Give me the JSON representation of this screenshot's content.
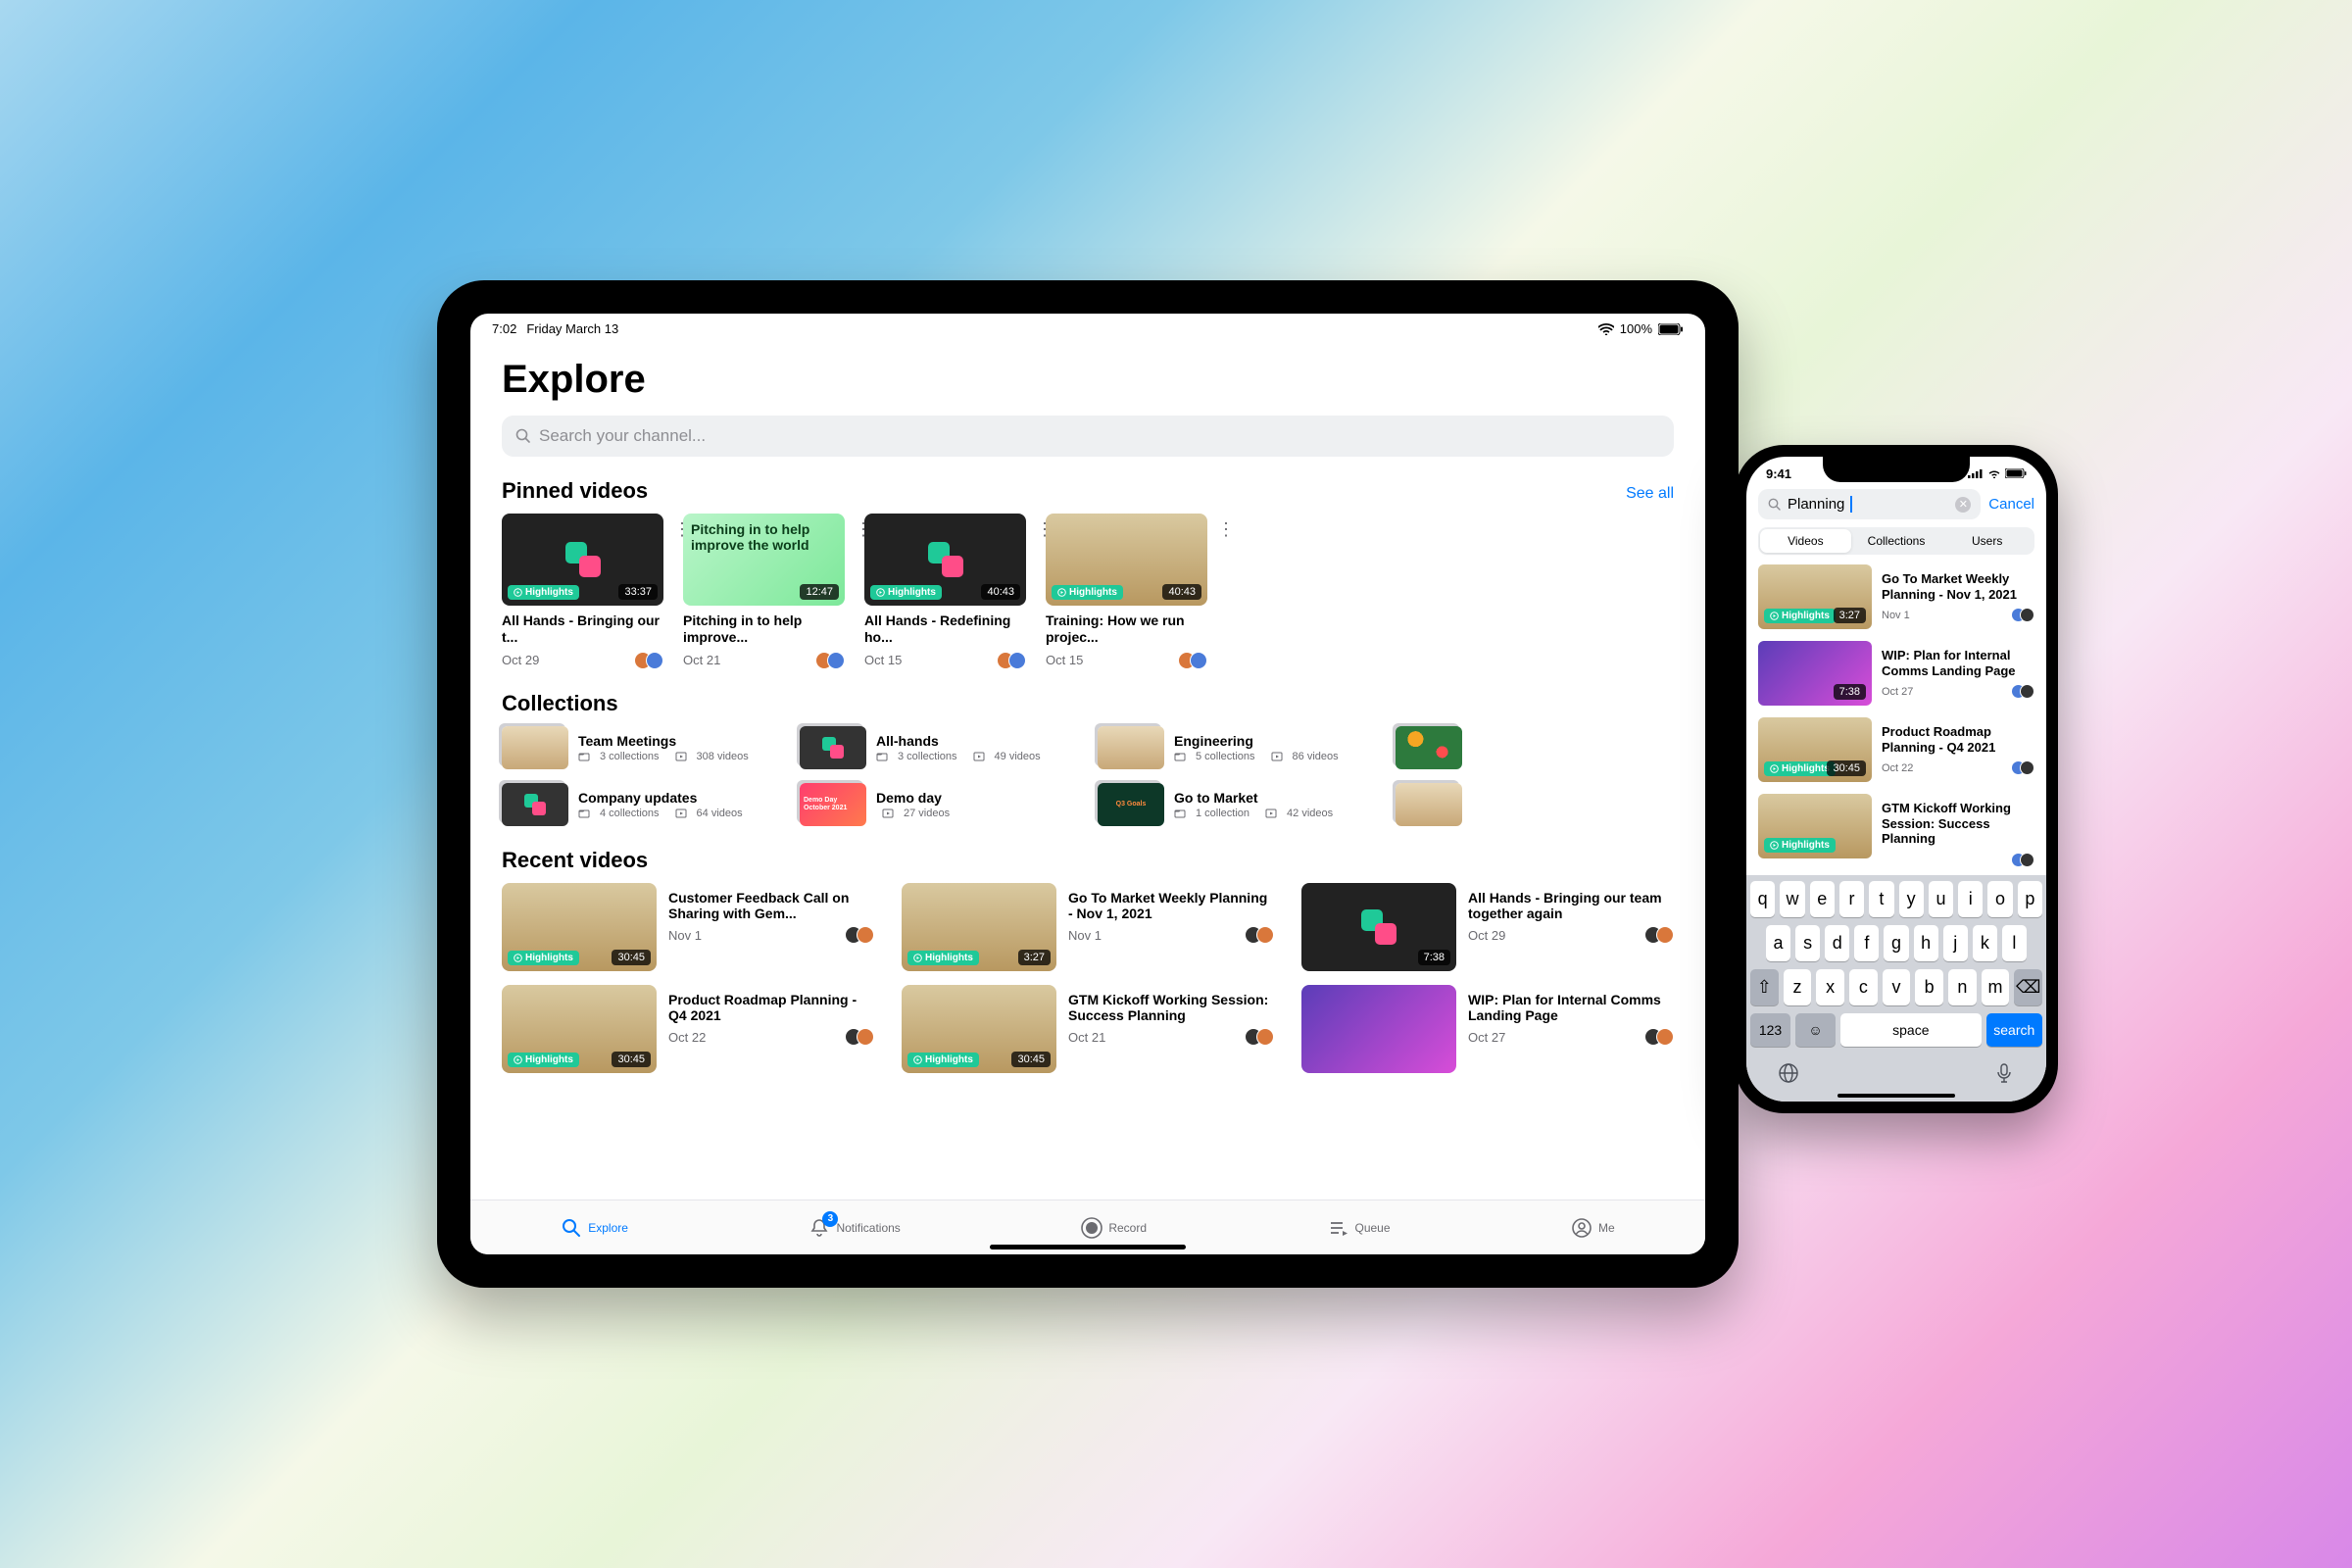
{
  "ipad": {
    "status": {
      "time": "7:02",
      "date": "Friday March 13",
      "battery": "100%"
    },
    "title": "Explore",
    "search_placeholder": "Search your channel...",
    "sections": {
      "pinned": {
        "heading": "Pinned videos",
        "see_all": "See all"
      },
      "collections": {
        "heading": "Collections"
      },
      "recent": {
        "heading": "Recent videos"
      }
    },
    "pinned": [
      {
        "title": "All Hands - Bringing our t...",
        "date": "Oct 29",
        "duration": "33:37",
        "badge": "Highlights",
        "thumb": "logo"
      },
      {
        "title": "Pitching in to help improve...",
        "date": "Oct 21",
        "duration": "12:47",
        "badge": "",
        "thumb": "green",
        "thumb_text": "Pitching in to help improve the world"
      },
      {
        "title": "All Hands - Redefining ho...",
        "date": "Oct 15",
        "duration": "40:43",
        "badge": "Highlights",
        "thumb": "logo"
      },
      {
        "title": "Training: How we run projec...",
        "date": "Oct 15",
        "duration": "40:43",
        "badge": "Highlights",
        "thumb": "person"
      }
    ],
    "collections": [
      {
        "title": "Team Meetings",
        "collections": "3 collections",
        "videos": "308 videos",
        "thumb": "photo"
      },
      {
        "title": "All-hands",
        "collections": "3 collections",
        "videos": "49 videos",
        "thumb": "logo"
      },
      {
        "title": "Engineering",
        "collections": "5 collections",
        "videos": "86 videos",
        "thumb": "photo"
      },
      {
        "title": "",
        "collections": "",
        "videos": "",
        "thumb": "fruit"
      },
      {
        "title": "Company updates",
        "collections": "4 collections",
        "videos": "64 videos",
        "thumb": "logo"
      },
      {
        "title": "Demo day",
        "collections": "",
        "videos": "27 videos",
        "thumb": "pink",
        "thumb_text": "Demo Day October 2021"
      },
      {
        "title": "Go to Market",
        "collections": "1 collection",
        "videos": "42 videos",
        "thumb": "green",
        "thumb_text": "Q3 Goals"
      },
      {
        "title": "",
        "collections": "",
        "videos": "",
        "thumb": "photo"
      }
    ],
    "recent": [
      {
        "title": "Customer Feedback Call on Sharing with Gem...",
        "date": "Nov 1",
        "duration": "30:45",
        "badge": "Highlights",
        "thumb": "person"
      },
      {
        "title": "Go To Market Weekly Planning - Nov 1, 2021",
        "date": "Nov 1",
        "duration": "3:27",
        "badge": "Highlights",
        "thumb": "person"
      },
      {
        "title": "All Hands - Bringing our team together again",
        "date": "Oct 29",
        "duration": "7:38",
        "badge": "",
        "thumb": "logo"
      },
      {
        "title": "Product Roadmap Planning - Q4 2021",
        "date": "Oct 22",
        "duration": "30:45",
        "badge": "Highlights",
        "thumb": "person"
      },
      {
        "title": "GTM Kickoff Working Session: Success Planning",
        "date": "Oct 21",
        "duration": "30:45",
        "badge": "Highlights",
        "thumb": "person"
      },
      {
        "title": "WIP: Plan for Internal Comms Landing Page",
        "date": "Oct 27",
        "duration": "",
        "badge": "",
        "thumb": "comms"
      }
    ],
    "tabs": {
      "explore": "Explore",
      "notifications": "Notifications",
      "notifications_badge": "3",
      "record": "Record",
      "queue": "Queue",
      "me": "Me"
    }
  },
  "iphone": {
    "status_time": "9:41",
    "search_query": "Planning",
    "cancel": "Cancel",
    "segments": {
      "videos": "Videos",
      "collections": "Collections",
      "users": "Users"
    },
    "results": [
      {
        "title": "Go To Market Weekly Planning - Nov 1, 2021",
        "date": "Nov 1",
        "duration": "3:27",
        "badge": "Highlights",
        "thumb": "person"
      },
      {
        "title": "WIP: Plan for Internal Comms Landing Page",
        "date": "Oct 27",
        "duration": "7:38",
        "badge": "",
        "thumb": "comms"
      },
      {
        "title": "Product Roadmap Planning - Q4 2021",
        "date": "Oct 22",
        "duration": "30:45",
        "badge": "Highlights",
        "thumb": "person"
      },
      {
        "title": "GTM Kickoff Working Session: Success Planning",
        "date": "",
        "duration": "",
        "badge": "Highlights",
        "thumb": "person"
      }
    ],
    "keyboard": {
      "row1": [
        "q",
        "w",
        "e",
        "r",
        "t",
        "y",
        "u",
        "i",
        "o",
        "p"
      ],
      "row2": [
        "a",
        "s",
        "d",
        "f",
        "g",
        "h",
        "j",
        "k",
        "l"
      ],
      "row3": [
        "z",
        "x",
        "c",
        "v",
        "b",
        "n",
        "m"
      ],
      "numbers": "123",
      "space": "space",
      "search": "search"
    }
  }
}
